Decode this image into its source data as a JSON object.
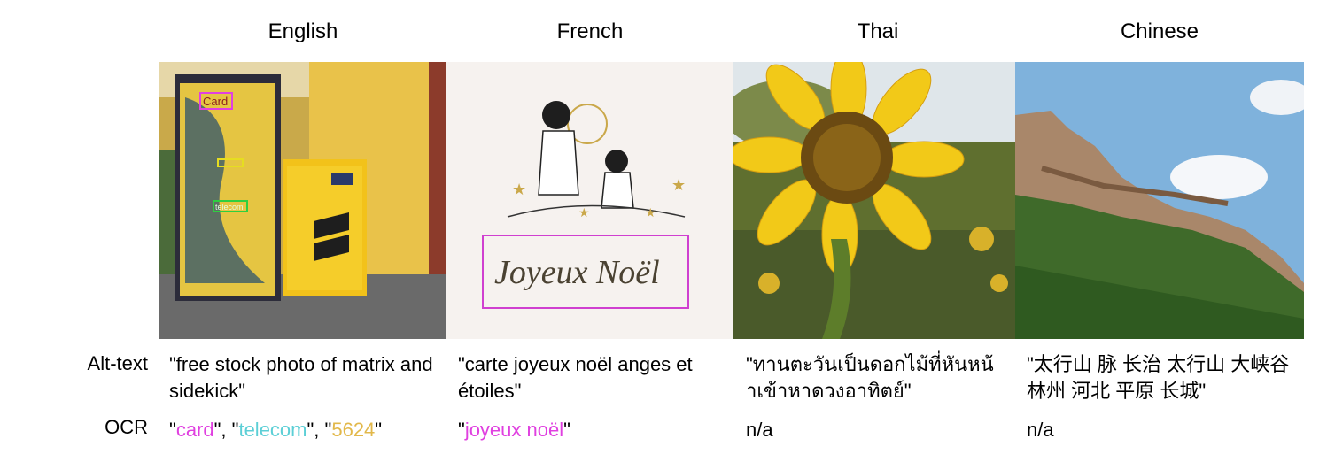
{
  "columns": [
    {
      "header": "English"
    },
    {
      "header": "French"
    },
    {
      "header": "Thai"
    },
    {
      "header": "Chinese"
    }
  ],
  "images": {
    "english": {
      "box_labels": [
        "Card",
        "telecom"
      ]
    },
    "french": {
      "script_text": "Joyeux Noël"
    }
  },
  "rows": {
    "alt_label": "Alt-text",
    "ocr_label": "OCR"
  },
  "alt_text": {
    "english": "\"free stock photo of matrix and sidekick\"",
    "french": "\"carte joyeux noël anges et étoiles\"",
    "thai": "\"ทานตะวันเป็นดอกไม้ที่หันหน้าเข้าหาดวงอาทิตย์\"",
    "chinese": "\"太行山 脉 长治 太行山 大峡谷 林州 河北 平原 长城\""
  },
  "ocr": {
    "english": {
      "parts": [
        {
          "text": "\"",
          "color": "#000000"
        },
        {
          "text": "card",
          "color": "#e040e0"
        },
        {
          "text": "\", \"",
          "color": "#000000"
        },
        {
          "text": "telecom",
          "color": "#5ccfd6"
        },
        {
          "text": "\", \"",
          "color": "#000000"
        },
        {
          "text": "5624",
          "color": "#e2b84a"
        },
        {
          "text": "\"",
          "color": "#000000"
        }
      ]
    },
    "french": {
      "parts": [
        {
          "text": "\"",
          "color": "#000000"
        },
        {
          "text": "joyeux noël",
          "color": "#e040e0"
        },
        {
          "text": "\"",
          "color": "#000000"
        }
      ]
    },
    "thai": "n/a",
    "chinese": "n/a"
  },
  "colors": {
    "magenta": "#e040e0",
    "cyan": "#5ccfd6",
    "gold": "#e2b84a"
  }
}
